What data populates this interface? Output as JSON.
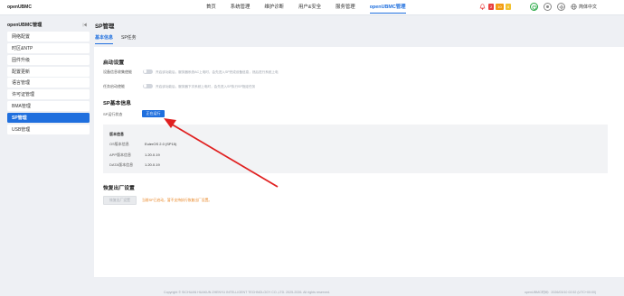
{
  "app": {
    "logo": "openUBMC"
  },
  "nav": {
    "items": [
      "首页",
      "系统管理",
      "维护诊断",
      "用户&安全",
      "服务管理",
      "openUBMC管理"
    ],
    "active_index": 5
  },
  "alerts": {
    "critical": "2",
    "major": "10",
    "minor": "4"
  },
  "header": {
    "language": "简体中文"
  },
  "sidebar": {
    "title": "openUBMC管理",
    "items": [
      "网络配置",
      "时区&NTP",
      "固件升级",
      "配置更新",
      "语言管理",
      "许可证管理",
      "BMA管理",
      "SP管理",
      "USB管理"
    ],
    "active_index": 7
  },
  "page": {
    "title": "SP管理",
    "tabs": [
      "基本信息",
      "SP任务"
    ]
  },
  "startup": {
    "title": "启动设置",
    "rows": [
      {
        "label": "设备信息收集使能",
        "desc": "开启该功能后，服务器系统AC上电时，会先进入SP完成设备信息，然后进行系统上电"
      },
      {
        "label": "任务启动使能",
        "desc": "开启该功能后，服务器下次系统上电时，会先进入SP执行SP指定任务"
      }
    ]
  },
  "sp_info": {
    "title": "SP基本信息",
    "status_label": "SP运行状态",
    "status_value": "正在运行",
    "box_title": "版本信息",
    "rows": [
      {
        "label": "OS版本信息",
        "value": "EulerOS 2.0 (SP15)"
      },
      {
        "label": "APP版本信息",
        "value": "1.20.0.19"
      },
      {
        "label": "DATA版本信息",
        "value": "1.20.0.19"
      }
    ]
  },
  "restore": {
    "title": "恢复出厂设置",
    "button": "恢复出厂设置",
    "warning": "当前SP已启动，暂不支持执行恢复出厂设置。"
  },
  "footer": {
    "copyright": "Copyright © SICHUAN HUAKUN ZHENYU INTELLIGENT TECHNOLOGY CO.,LTD. 2025-2026. All rights reserved.",
    "server_time": "openUBMC时间：2026/03/10 02:52 (UTC+00:00)"
  },
  "colors": {
    "accent": "#1f6fde",
    "critical": "#e84040",
    "major": "#f39c12",
    "minor": "#f2c230",
    "arrow": "#e02020",
    "warning": "#e8821e"
  }
}
